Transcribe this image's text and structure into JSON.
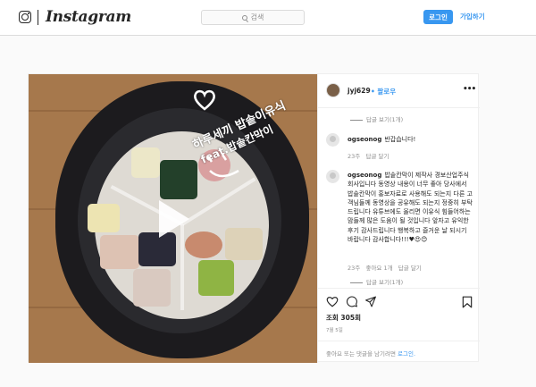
{
  "header": {
    "brand": "Instagram",
    "search_placeholder": "검색",
    "login_label": "로그인",
    "signup_label": "가입하기"
  },
  "post": {
    "author": "jyj629",
    "follow_label": "팔로우",
    "image_overlay": {
      "line1": "하루세끼 밥솥이유식",
      "line2": "feat.밥솥칸막이"
    }
  },
  "comments": [
    {
      "kind": "reply",
      "label": "답글 보기(1개)"
    },
    {
      "kind": "comment",
      "user": "ogseonog",
      "text": "반갑습니다!",
      "age": "23주",
      "reply": "답글 달기"
    },
    {
      "kind": "comment",
      "user": "ogseonog",
      "text": "밥솥칸막이 제작사 경보산업주식회사입니다 동영상 내용이 너무 좋아 당사에서 밥솥칸막이 홍보자료로 사용해도 되는지 다른 고객님들께 동영상을 공유해도 되는지 정중히 부탁드립니다 유튜브에도 올리면 이유식 힘들어하는 맘들께 많은 도움이 될 것입니다 앞자고 유익한 후기 감사드립니다 행복하고 즐거운 날 되시기 바랍니다 감사합니다!!!♥😍😊",
      "age": "23주",
      "likes": "좋아요 1개",
      "reply": "답글 달기"
    },
    {
      "kind": "reply",
      "label": "답글 보기(1개)"
    }
  ],
  "stats": {
    "views": "조회 305회",
    "date": "7월 5일"
  },
  "footer_prompt": {
    "text": "좋아요 또는 댓글을 남기려면",
    "login_link": "로그인."
  }
}
